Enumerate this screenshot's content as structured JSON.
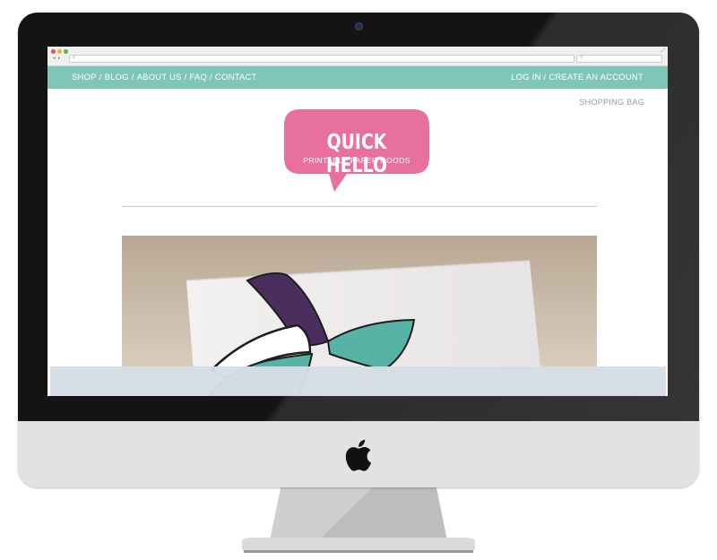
{
  "browser": {
    "nav_arrows": "◂ ▸",
    "url_icon": "≡",
    "search_icon": "⚲",
    "expand_icon": "⤢"
  },
  "nav": {
    "left_items": [
      "SHOP",
      "BLOG",
      "ABOUT US",
      "FAQ",
      "CONTACT"
    ],
    "separator": "/",
    "right_items": [
      "LOG IN",
      "CREATE AN ACCOUNT"
    ]
  },
  "shopping_bag": "SHOPPING BAG",
  "logo": {
    "title": "QUICK HELLO",
    "subtitle": "PRINTABLE PAPER GOODS"
  },
  "colors": {
    "nav_bg": "#7fc6b9",
    "logo_pink": "#e8709e",
    "purple": "#4a2f5e",
    "teal": "#58b3a7"
  },
  "icons": [
    "apple-logo-icon",
    "camera-icon",
    "search-icon",
    "expand-icon"
  ]
}
